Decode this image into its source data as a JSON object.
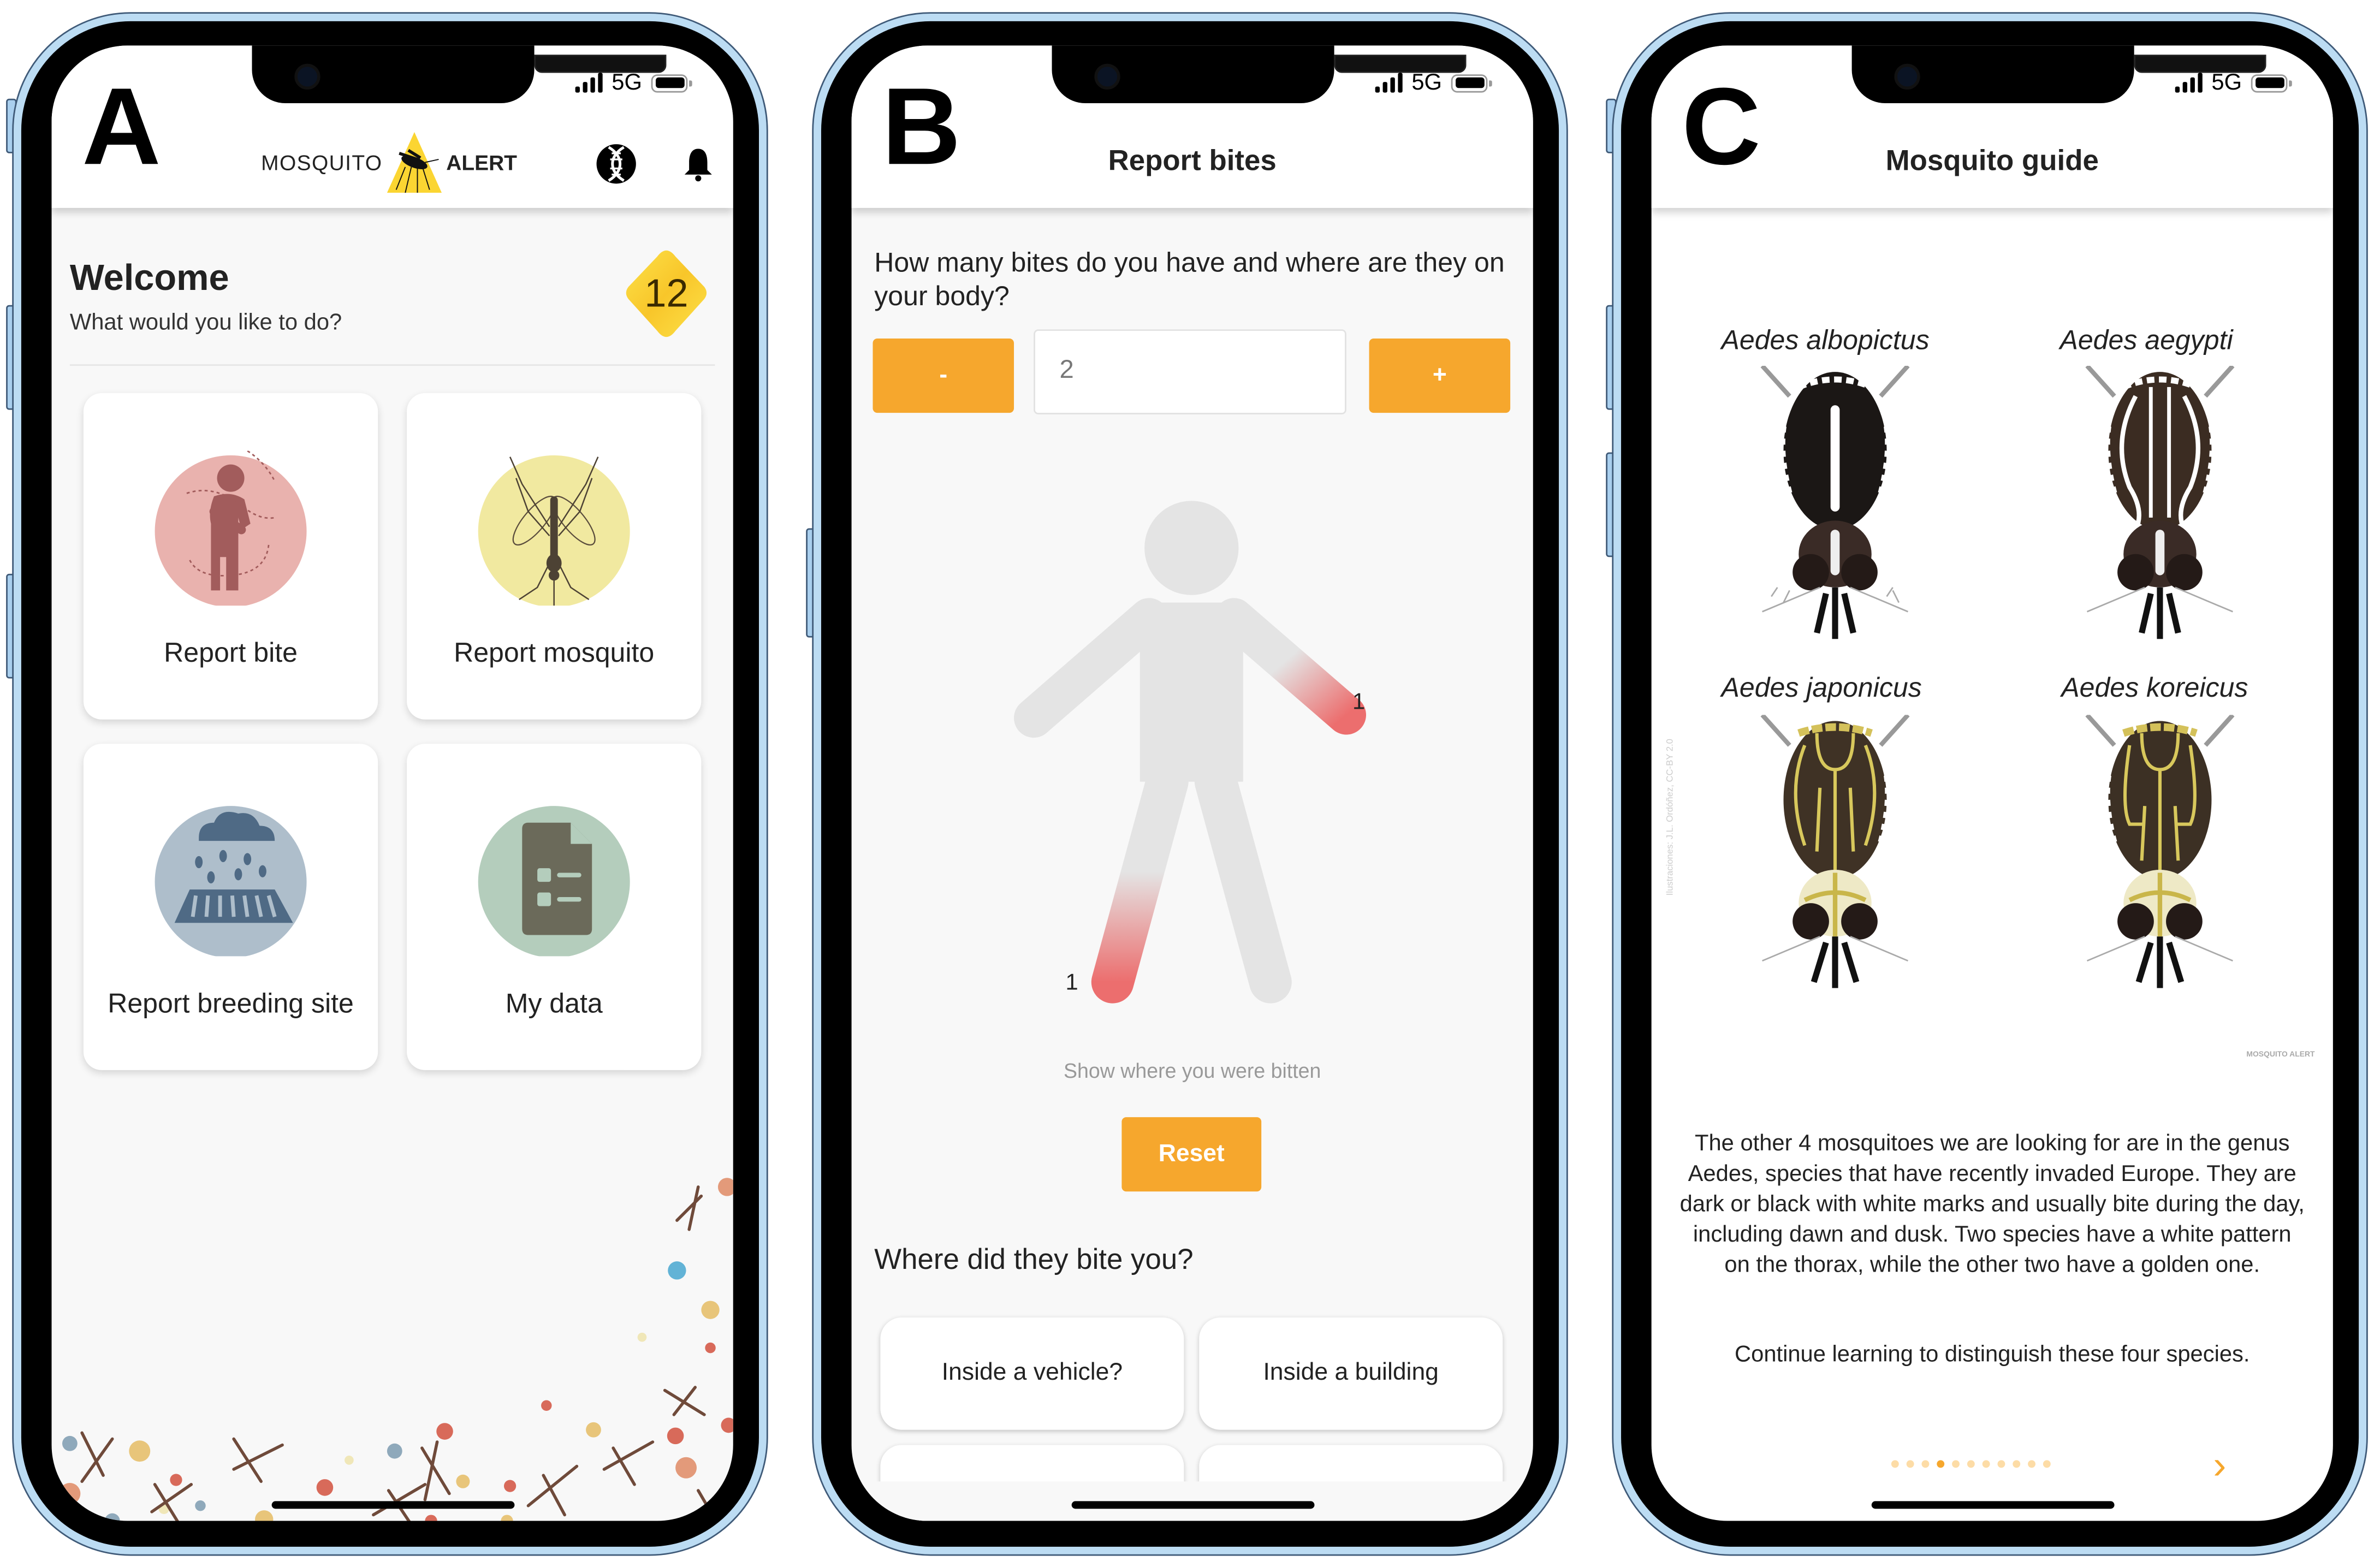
{
  "status_bar": {
    "network": "5G"
  },
  "panels": [
    {
      "letter": "A",
      "header": {
        "logo_left": "MOSQUITO",
        "logo_right": "ALERT",
        "icons": [
          "dna-icon",
          "bell-icon"
        ]
      },
      "welcome": {
        "title": "Welcome",
        "subtitle": "What would you like to do?"
      },
      "badge": {
        "value": "12"
      },
      "cards": [
        {
          "label": "Report bite",
          "icon": "person-bite-icon",
          "color": "#e9b2ae"
        },
        {
          "label": "Report mosquito",
          "icon": "mosquito-icon",
          "color": "#f1e9a0"
        },
        {
          "label": "Report breeding site",
          "icon": "rain-drain-icon",
          "color": "#aebecb"
        },
        {
          "label": "My data",
          "icon": "document-list-icon",
          "color": "#b4cdbc"
        }
      ]
    },
    {
      "letter": "B",
      "title": "Report bites",
      "question": "How many bites do you have and where are they on your body?",
      "stepper": {
        "minus": "-",
        "plus": "+",
        "value": "2"
      },
      "body_marks": [
        {
          "part": "left-arm",
          "count": "1"
        },
        {
          "part": "right-leg",
          "count": "1"
        }
      ],
      "hint": "Show where you were bitten",
      "reset_label": "Reset",
      "where_title": "Where did they bite you?",
      "options": [
        "Inside a vehicle?",
        "Inside a building",
        "",
        ""
      ]
    },
    {
      "letter": "C",
      "title": "Mosquito guide",
      "species": [
        {
          "name": "Aedes albopictus",
          "pattern": "white"
        },
        {
          "name": "Aedes aegypti",
          "pattern": "white"
        },
        {
          "name": "Aedes japonicus",
          "pattern": "golden"
        },
        {
          "name": "Aedes koreicus",
          "pattern": "golden"
        }
      ],
      "credit": "Ilustraciones: J.L. Ordóñez, CC-BY 2.0",
      "watermark": "MOSQUITO ALERT",
      "description": "The other 4 mosquitoes we are looking for are in the genus Aedes, species that have recently invaded Europe. They are dark or black with white marks and usually bite during the day, including dawn and dusk. Two species have a white pattern on the thorax, while the other two have a golden one.",
      "description2": "Continue learning to distinguish these four species.",
      "pager": {
        "total": 11,
        "current": 4
      },
      "next_label": "›"
    }
  ],
  "colors": {
    "accent_orange": "#f6a72d",
    "badge_yellow": "#fbd532",
    "frame_blue": "#bcdcf3"
  }
}
